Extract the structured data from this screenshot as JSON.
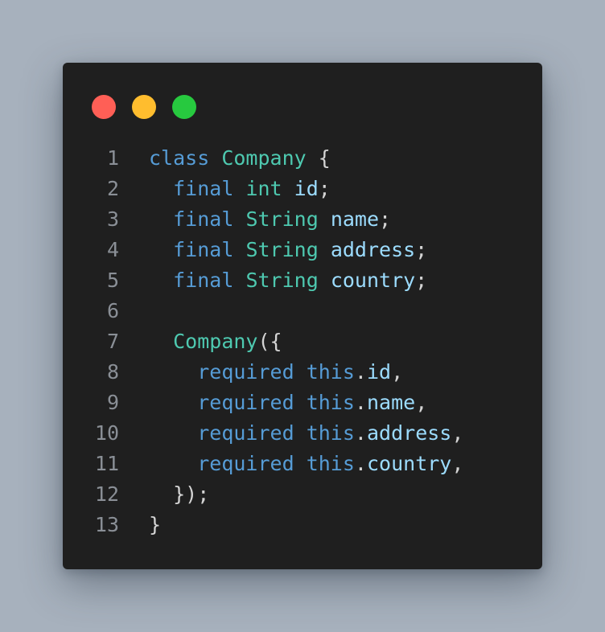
{
  "window": {
    "traffic_lights": {
      "close_color": "#ff5f56",
      "minimize_color": "#ffbd2e",
      "maximize_color": "#27c93f"
    }
  },
  "code": {
    "lines": [
      {
        "number": "1",
        "tokens": [
          {
            "text": "class",
            "kind": "keyword"
          },
          {
            "text": " ",
            "kind": "plain"
          },
          {
            "text": "Company",
            "kind": "type"
          },
          {
            "text": " {",
            "kind": "punctuation"
          }
        ]
      },
      {
        "number": "2",
        "tokens": [
          {
            "text": "  ",
            "kind": "plain"
          },
          {
            "text": "final",
            "kind": "keyword"
          },
          {
            "text": " ",
            "kind": "plain"
          },
          {
            "text": "int",
            "kind": "type"
          },
          {
            "text": " ",
            "kind": "plain"
          },
          {
            "text": "id",
            "kind": "variable"
          },
          {
            "text": ";",
            "kind": "punctuation"
          }
        ]
      },
      {
        "number": "3",
        "tokens": [
          {
            "text": "  ",
            "kind": "plain"
          },
          {
            "text": "final",
            "kind": "keyword"
          },
          {
            "text": " ",
            "kind": "plain"
          },
          {
            "text": "String",
            "kind": "type"
          },
          {
            "text": " ",
            "kind": "plain"
          },
          {
            "text": "name",
            "kind": "variable"
          },
          {
            "text": ";",
            "kind": "punctuation"
          }
        ]
      },
      {
        "number": "4",
        "tokens": [
          {
            "text": "  ",
            "kind": "plain"
          },
          {
            "text": "final",
            "kind": "keyword"
          },
          {
            "text": " ",
            "kind": "plain"
          },
          {
            "text": "String",
            "kind": "type"
          },
          {
            "text": " ",
            "kind": "plain"
          },
          {
            "text": "address",
            "kind": "variable"
          },
          {
            "text": ";",
            "kind": "punctuation"
          }
        ]
      },
      {
        "number": "5",
        "tokens": [
          {
            "text": "  ",
            "kind": "plain"
          },
          {
            "text": "final",
            "kind": "keyword"
          },
          {
            "text": " ",
            "kind": "plain"
          },
          {
            "text": "String",
            "kind": "type"
          },
          {
            "text": " ",
            "kind": "plain"
          },
          {
            "text": "country",
            "kind": "variable"
          },
          {
            "text": ";",
            "kind": "punctuation"
          }
        ]
      },
      {
        "number": "6",
        "tokens": []
      },
      {
        "number": "7",
        "tokens": [
          {
            "text": "  ",
            "kind": "plain"
          },
          {
            "text": "Company",
            "kind": "type"
          },
          {
            "text": "({",
            "kind": "punctuation"
          }
        ]
      },
      {
        "number": "8",
        "tokens": [
          {
            "text": "    ",
            "kind": "plain"
          },
          {
            "text": "required",
            "kind": "keyword"
          },
          {
            "text": " ",
            "kind": "plain"
          },
          {
            "text": "this",
            "kind": "keyword"
          },
          {
            "text": ".",
            "kind": "punctuation"
          },
          {
            "text": "id",
            "kind": "variable"
          },
          {
            "text": ",",
            "kind": "punctuation"
          }
        ]
      },
      {
        "number": "9",
        "tokens": [
          {
            "text": "    ",
            "kind": "plain"
          },
          {
            "text": "required",
            "kind": "keyword"
          },
          {
            "text": " ",
            "kind": "plain"
          },
          {
            "text": "this",
            "kind": "keyword"
          },
          {
            "text": ".",
            "kind": "punctuation"
          },
          {
            "text": "name",
            "kind": "variable"
          },
          {
            "text": ",",
            "kind": "punctuation"
          }
        ]
      },
      {
        "number": "10",
        "tokens": [
          {
            "text": "    ",
            "kind": "plain"
          },
          {
            "text": "required",
            "kind": "keyword"
          },
          {
            "text": " ",
            "kind": "plain"
          },
          {
            "text": "this",
            "kind": "keyword"
          },
          {
            "text": ".",
            "kind": "punctuation"
          },
          {
            "text": "address",
            "kind": "variable"
          },
          {
            "text": ",",
            "kind": "punctuation"
          }
        ]
      },
      {
        "number": "11",
        "tokens": [
          {
            "text": "    ",
            "kind": "plain"
          },
          {
            "text": "required",
            "kind": "keyword"
          },
          {
            "text": " ",
            "kind": "plain"
          },
          {
            "text": "this",
            "kind": "keyword"
          },
          {
            "text": ".",
            "kind": "punctuation"
          },
          {
            "text": "country",
            "kind": "variable"
          },
          {
            "text": ",",
            "kind": "punctuation"
          }
        ]
      },
      {
        "number": "12",
        "tokens": [
          {
            "text": "  ",
            "kind": "plain"
          },
          {
            "text": "});",
            "kind": "punctuation"
          }
        ]
      },
      {
        "number": "13",
        "tokens": [
          {
            "text": "}",
            "kind": "punctuation"
          }
        ]
      }
    ]
  }
}
